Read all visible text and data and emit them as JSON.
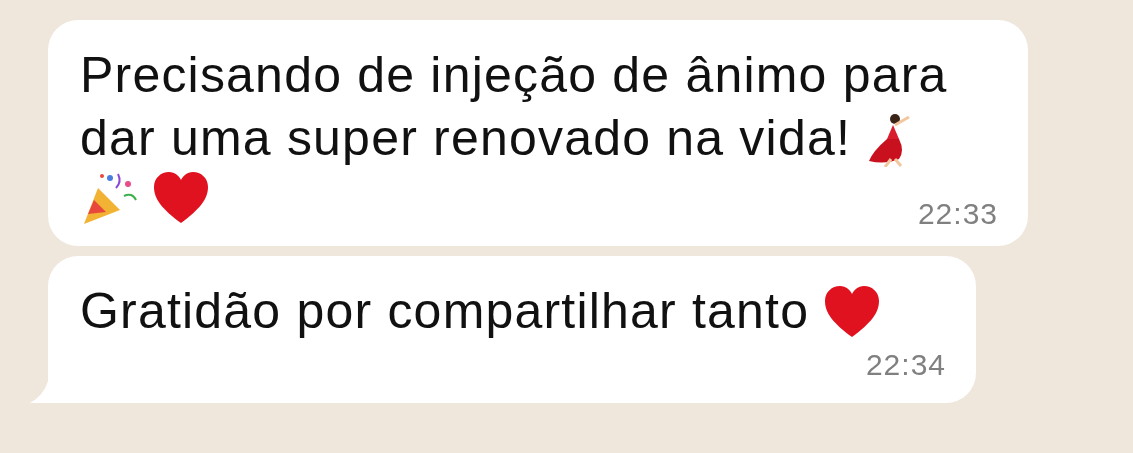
{
  "messages": [
    {
      "lines": [
        [
          {
            "kind": "text",
            "text": "Precisando de injeção de ânimo para"
          }
        ],
        [
          {
            "kind": "text",
            "text": "dar uma super renovado na vida!"
          },
          {
            "kind": "dancer"
          }
        ],
        [
          {
            "kind": "party"
          },
          {
            "kind": "heart"
          }
        ]
      ],
      "time": "22:33",
      "tail": false
    },
    {
      "lines": [
        [
          {
            "kind": "text",
            "text": "Gratidão por compartilhar tanto"
          },
          {
            "kind": "heart"
          }
        ]
      ],
      "time": "22:34",
      "tail": true
    }
  ]
}
